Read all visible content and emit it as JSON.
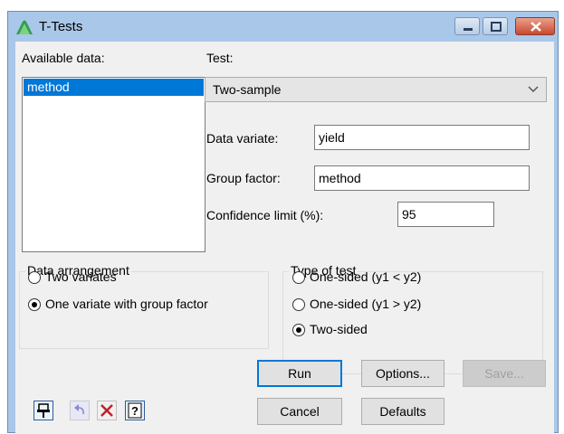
{
  "window": {
    "title": "T-Tests",
    "icon": "genstat-triangle-icon",
    "controls": [
      "minimize-icon",
      "maximize-icon",
      "close-icon"
    ]
  },
  "left": {
    "available_label": "Available data:",
    "list_items": [
      "method"
    ],
    "selected_item": "method"
  },
  "test": {
    "label": "Test:",
    "selected": "Two-sample"
  },
  "fields": {
    "data_variate_label": "Data variate:",
    "data_variate_value": "yield",
    "group_factor_label": "Group factor:",
    "group_factor_value": "method",
    "confidence_label": "Confidence limit (%):",
    "confidence_value": "95"
  },
  "arrangement": {
    "title": "Data arrangement",
    "options": [
      "Two variates",
      "One variate with group factor"
    ],
    "selected_index": 1
  },
  "type_of_test": {
    "title": "Type of test",
    "options": [
      "One-sided (y1 < y2)",
      "One-sided (y1 > y2)",
      "Two-sided"
    ],
    "selected_index": 2
  },
  "buttons": {
    "run": "Run",
    "options": "Options...",
    "save": "Save...",
    "cancel": "Cancel",
    "defaults": "Defaults"
  },
  "toolbar_icons": [
    "pin-icon",
    "undo-icon",
    "clear-icon",
    "help-icon"
  ],
  "colors": {
    "title_bar": "#a9c7e8",
    "selection": "#0078d7",
    "default_button_border": "#0078d7",
    "close_button": "#c8492f"
  }
}
